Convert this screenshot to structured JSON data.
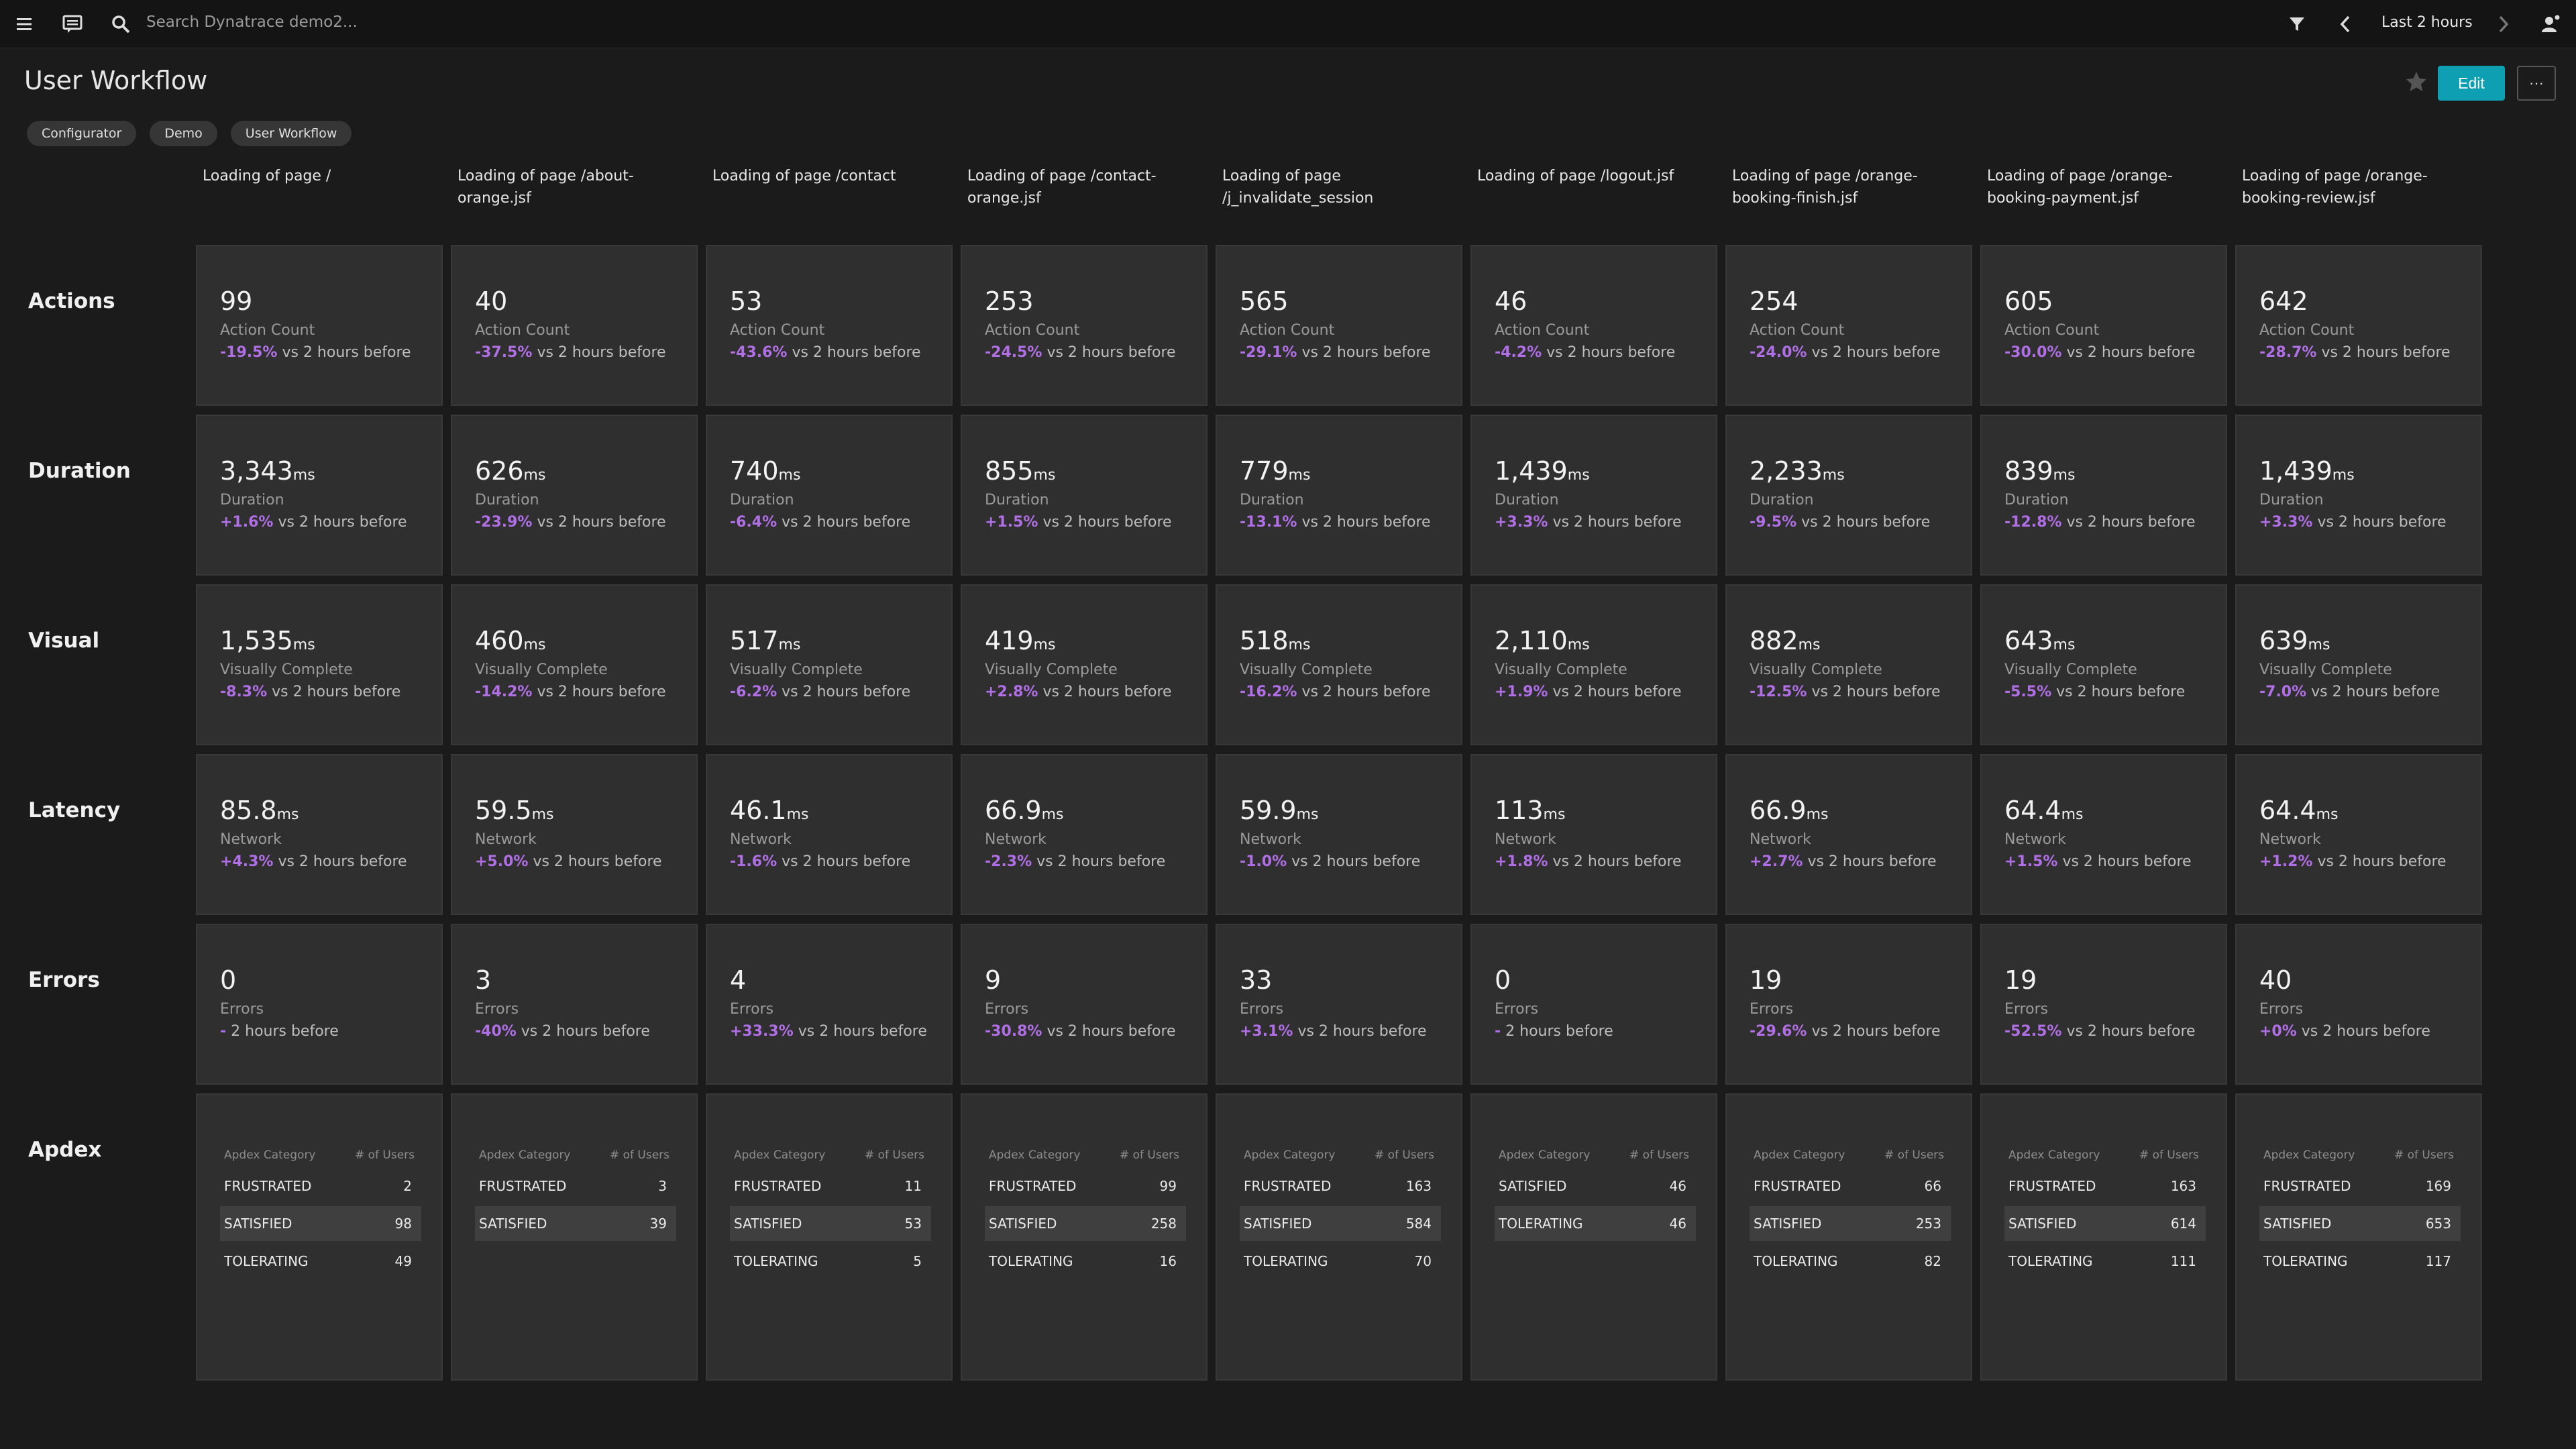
{
  "topbar": {
    "search_placeholder": "Search Dynatrace demo2...",
    "timeframe": "Last 2 hours"
  },
  "header": {
    "title": "User Workflow",
    "edit_label": "Edit",
    "more_label": "···",
    "chips": [
      "Configurator",
      "Demo",
      "User Workflow"
    ]
  },
  "columns": [
    [
      "Loading of page /",
      ""
    ],
    [
      "Loading of page /about-",
      "orange.jsf"
    ],
    [
      "Loading of page /contact",
      ""
    ],
    [
      "Loading of page /contact-",
      "orange.jsf"
    ],
    [
      "Loading of page",
      "/j_invalidate_session"
    ],
    [
      "Loading of page /logout.jsf",
      ""
    ],
    [
      "Loading of page /orange-",
      "booking-finish.jsf"
    ],
    [
      "Loading of page /orange-",
      "booking-payment.jsf"
    ],
    [
      "Loading of page /orange-",
      "booking-review.jsf"
    ]
  ],
  "compare_suffix": " vs 2 hours before",
  "rows": [
    {
      "label": "Actions",
      "metric": "Action Count",
      "unit": "",
      "tiles": [
        {
          "value": "99",
          "pct": "-19.5%"
        },
        {
          "value": "40",
          "pct": "-37.5%"
        },
        {
          "value": "53",
          "pct": "-43.6%"
        },
        {
          "value": "253",
          "pct": "-24.5%"
        },
        {
          "value": "565",
          "pct": "-29.1%"
        },
        {
          "value": "46",
          "pct": "-4.2%"
        },
        {
          "value": "254",
          "pct": "-24.0%"
        },
        {
          "value": "605",
          "pct": "-30.0%"
        },
        {
          "value": "642",
          "pct": "-28.7%"
        }
      ]
    },
    {
      "label": "Duration",
      "metric": "Duration",
      "unit": "ms",
      "tiles": [
        {
          "value": "3,343",
          "pct": "+1.6%"
        },
        {
          "value": "626",
          "pct": "-23.9%"
        },
        {
          "value": "740",
          "pct": "-6.4%"
        },
        {
          "value": "855",
          "pct": "+1.5%"
        },
        {
          "value": "779",
          "pct": "-13.1%"
        },
        {
          "value": "1,439",
          "pct": "+3.3%"
        },
        {
          "value": "2,233",
          "pct": "-9.5%"
        },
        {
          "value": "839",
          "pct": "-12.8%"
        },
        {
          "value": "1,439",
          "pct": "+3.3%"
        }
      ]
    },
    {
      "label": "Visual",
      "metric": "Visually Complete",
      "unit": "ms",
      "tiles": [
        {
          "value": "1,535",
          "pct": "-8.3%"
        },
        {
          "value": "460",
          "pct": "-14.2%"
        },
        {
          "value": "517",
          "pct": "-6.2%"
        },
        {
          "value": "419",
          "pct": "+2.8%"
        },
        {
          "value": "518",
          "pct": "-16.2%"
        },
        {
          "value": "2,110",
          "pct": "+1.9%"
        },
        {
          "value": "882",
          "pct": "-12.5%"
        },
        {
          "value": "643",
          "pct": "-5.5%"
        },
        {
          "value": "639",
          "pct": "-7.0%"
        }
      ]
    },
    {
      "label": "Latency",
      "metric": "Network",
      "unit": "ms",
      "tiles": [
        {
          "value": "85.8",
          "pct": "+4.3%"
        },
        {
          "value": "59.5",
          "pct": "+5.0%"
        },
        {
          "value": "46.1",
          "pct": "-1.6%"
        },
        {
          "value": "66.9",
          "pct": "-2.3%"
        },
        {
          "value": "59.9",
          "pct": "-1.0%"
        },
        {
          "value": "113",
          "pct": "+1.8%"
        },
        {
          "value": "66.9",
          "pct": "+2.7%"
        },
        {
          "value": "64.4",
          "pct": "+1.5%"
        },
        {
          "value": "64.4",
          "pct": "+1.2%"
        }
      ]
    },
    {
      "label": "Errors",
      "metric": "Errors",
      "unit": "",
      "tiles": [
        {
          "value": "0",
          "pct": "-",
          "suffix": " 2 hours before"
        },
        {
          "value": "3",
          "pct": "-40%"
        },
        {
          "value": "4",
          "pct": "+33.3%"
        },
        {
          "value": "9",
          "pct": "-30.8%"
        },
        {
          "value": "33",
          "pct": "+3.1%"
        },
        {
          "value": "0",
          "pct": "-",
          "suffix": " 2 hours before"
        },
        {
          "value": "19",
          "pct": "-29.6%"
        },
        {
          "value": "19",
          "pct": "-52.5%"
        },
        {
          "value": "40",
          "pct": "+0%"
        }
      ]
    }
  ],
  "apdex": {
    "label": "Apdex",
    "col_category": "Apdex Category",
    "col_users": "# of Users",
    "tables": [
      [
        [
          "FRUSTRATED",
          "2"
        ],
        [
          "SATISFIED",
          "98"
        ],
        [
          "TOLERATING",
          "49"
        ]
      ],
      [
        [
          "FRUSTRATED",
          "3"
        ],
        [
          "SATISFIED",
          "39"
        ]
      ],
      [
        [
          "FRUSTRATED",
          "11"
        ],
        [
          "SATISFIED",
          "53"
        ],
        [
          "TOLERATING",
          "5"
        ]
      ],
      [
        [
          "FRUSTRATED",
          "99"
        ],
        [
          "SATISFIED",
          "258"
        ],
        [
          "TOLERATING",
          "16"
        ]
      ],
      [
        [
          "FRUSTRATED",
          "163"
        ],
        [
          "SATISFIED",
          "584"
        ],
        [
          "TOLERATING",
          "70"
        ]
      ],
      [
        [
          "SATISFIED",
          "46"
        ],
        [
          "TOLERATING",
          "46"
        ]
      ],
      [
        [
          "FRUSTRATED",
          "66"
        ],
        [
          "SATISFIED",
          "253"
        ],
        [
          "TOLERATING",
          "82"
        ]
      ],
      [
        [
          "FRUSTRATED",
          "163"
        ],
        [
          "SATISFIED",
          "614"
        ],
        [
          "TOLERATING",
          "111"
        ]
      ],
      [
        [
          "FRUSTRATED",
          "169"
        ],
        [
          "SATISFIED",
          "653"
        ],
        [
          "TOLERATING",
          "117"
        ]
      ]
    ]
  },
  "icons": {
    "menu": "menu-icon",
    "notifications": "message-icon",
    "search": "search-icon",
    "filter": "filter-icon",
    "prev": "chevron-left-icon",
    "next": "chevron-right-icon",
    "user": "user-icon",
    "favorite": "star-icon"
  },
  "colors": {
    "accent": "#0e9fb3",
    "change": "#b16fe6",
    "tile_bg": "#2f2f2f",
    "page_bg": "#1b1b1b"
  }
}
